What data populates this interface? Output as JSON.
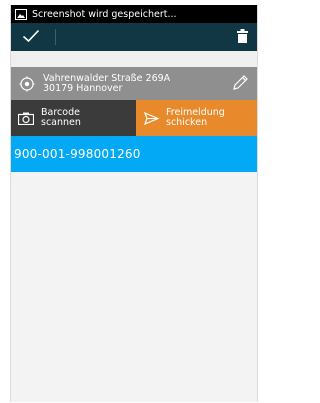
{
  "status_bar": {
    "notification": "Screenshot wird gespeichert..."
  },
  "action_bar": {
    "confirm_icon": "check-icon",
    "delete_icon": "trash-icon"
  },
  "address": {
    "street": "Vahrenwalder Straße 269A",
    "city": "30179 Hannover",
    "icon": "location-icon",
    "edit_icon": "pencil-icon"
  },
  "buttons": {
    "scan_line1": "Barcode",
    "scan_line2": "scannen",
    "send_line1": "Freimeldung",
    "send_line2": "schicken"
  },
  "items": [
    {
      "code": "900-001-998001260"
    }
  ],
  "colors": {
    "action_bar": "#113745",
    "address_bg": "#8f8f8f",
    "scan_bg": "#3b3b3b",
    "send_bg": "#e88a2b",
    "item_bg": "#03a9f4"
  }
}
